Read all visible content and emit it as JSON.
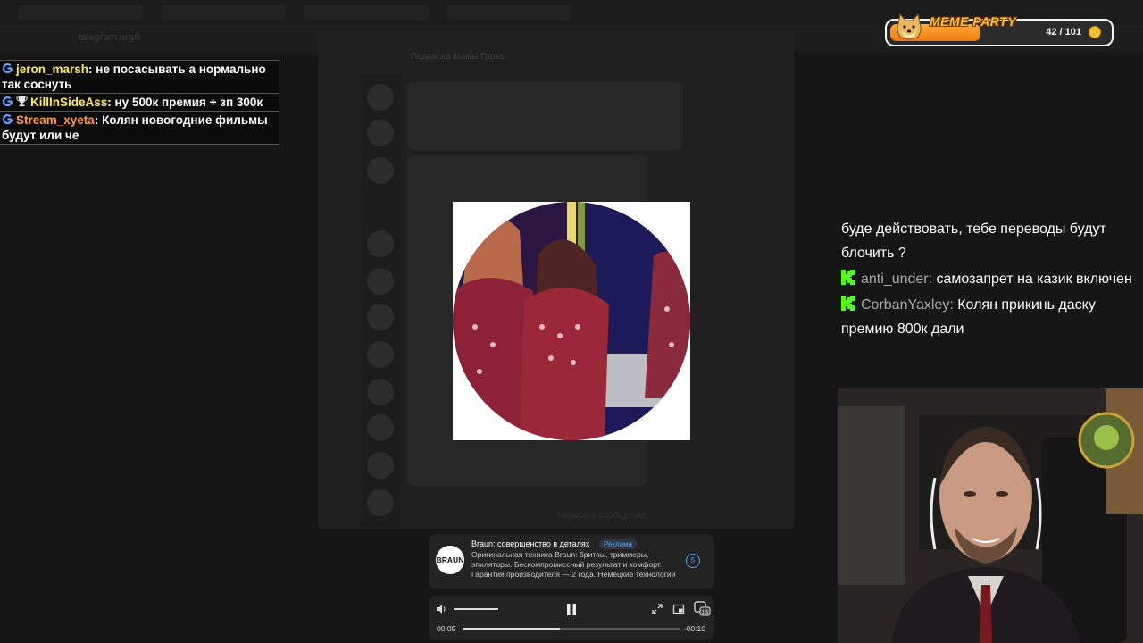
{
  "browser": {
    "address": "telegram.org/k"
  },
  "telegram": {
    "chat_title": "Подписка Мамы Гроза",
    "compose_hint": "Написать сообщение"
  },
  "chat_left": {
    "messages": [
      {
        "user": "jeron_marsh",
        "text": "не посасывать а нормально так соснуть",
        "badge": "none"
      },
      {
        "user": "KillInSideAss",
        "text": "ну 500к премия + зп 300к",
        "badge": "trophy"
      },
      {
        "user": "Stream_xyeta",
        "text": "Колян новогодние фильмы будут или че",
        "badge": "none"
      }
    ]
  },
  "meme_party": {
    "title": "MEME PARTY",
    "count": "42 / 101",
    "progress": 0.42
  },
  "chat_right": {
    "lead_text": "буде действовать, тебе переводы будут блочить ?",
    "messages": [
      {
        "user": "anti_under:",
        "text": "самозапрет на казик включен"
      },
      {
        "user": "CorbanYaxley:",
        "text": "Колян прикинь даску премию 800к дали"
      }
    ]
  },
  "ad": {
    "logo": "BRAUN",
    "title": "Braun: совершенство в деталях",
    "badge": "Реклама",
    "description": "Оригинальная техника Braun: бритвы, триммеры, эпиляторы. Бескомпромиссный результат и комфорт. Гарантия производителя — 2 года. Немецкие технологии",
    "countdown": "5"
  },
  "player": {
    "time_current": "00:09",
    "time_remaining": "-00:10",
    "progress": 0.45,
    "volume": 1.0,
    "speed_label": "1.5"
  },
  "colors": {
    "accent_yellow": "#ffe85c",
    "accent_orange": "#ff9a3c",
    "kick_green": "#53fc18",
    "ad_blue": "#5aa7e8"
  }
}
